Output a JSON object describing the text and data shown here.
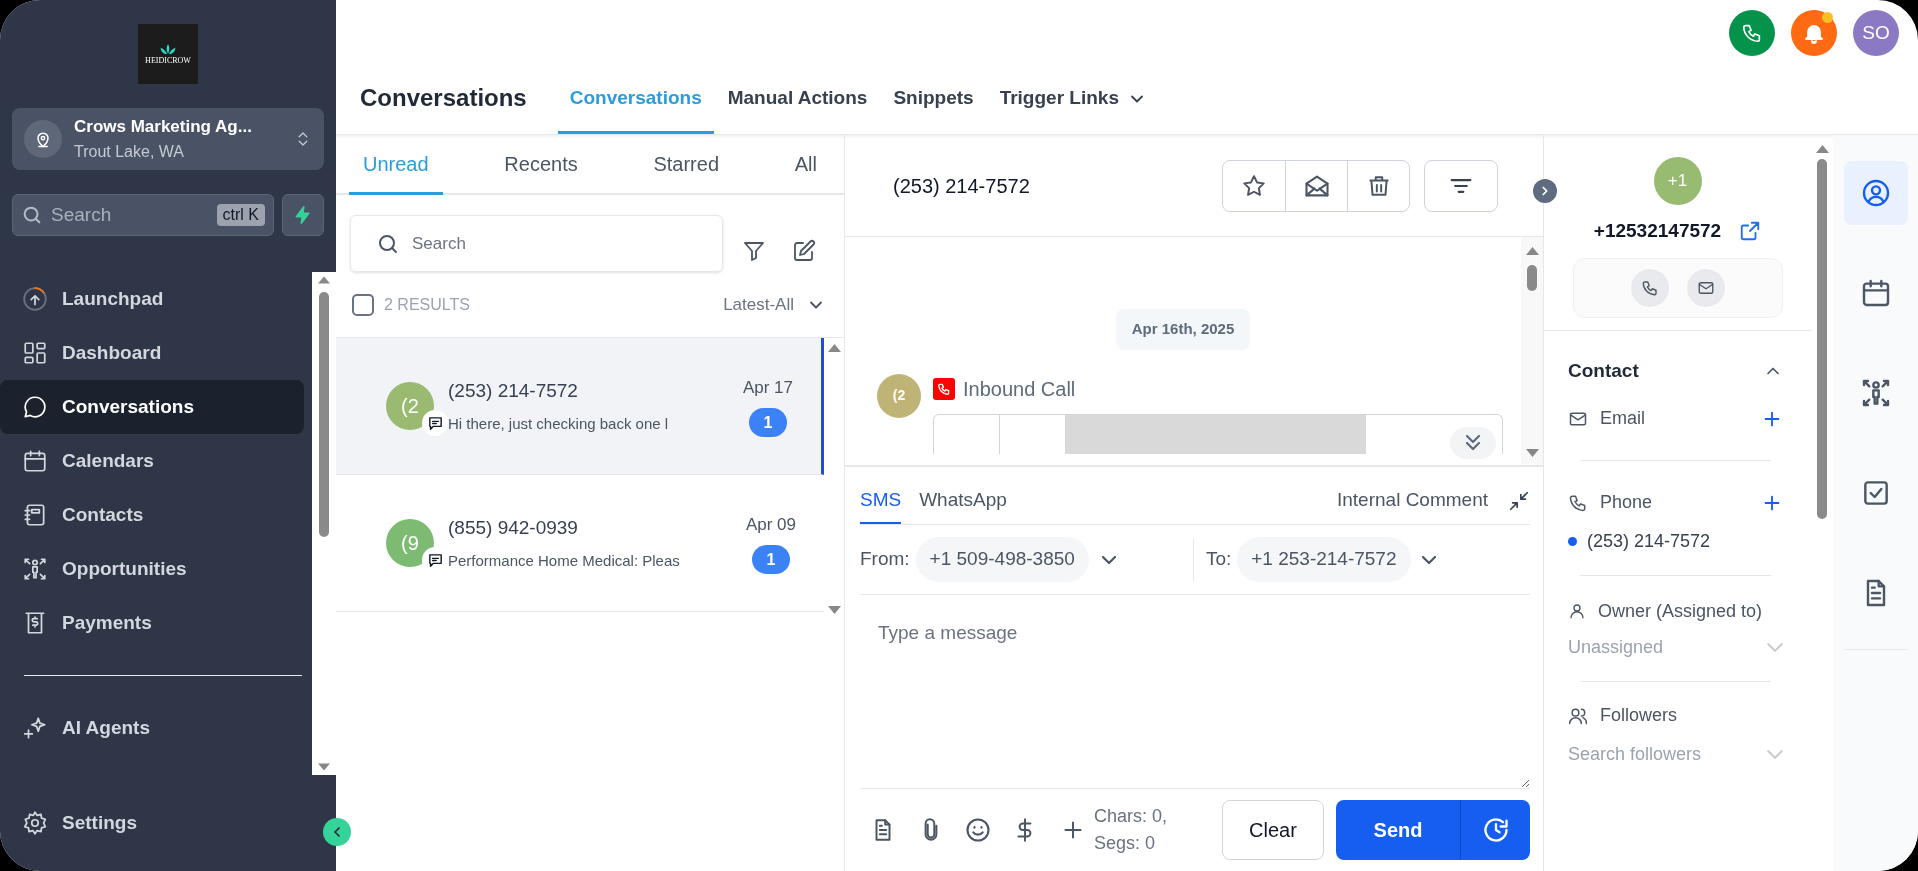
{
  "sidebar": {
    "logo_text": "HEIDICROW",
    "account": {
      "name": "Crows Marketing Ag...",
      "location": "Trout Lake, WA"
    },
    "search": {
      "placeholder": "Search",
      "shortcut": "ctrl K"
    },
    "nav_items": [
      {
        "label": "Launchpad",
        "selected": false
      },
      {
        "label": "Dashboard",
        "selected": false
      },
      {
        "label": "Conversations",
        "selected": true
      },
      {
        "label": "Calendars",
        "selected": false
      },
      {
        "label": "Contacts",
        "selected": false
      },
      {
        "label": "Opportunities",
        "selected": false
      },
      {
        "label": "Payments",
        "selected": false
      }
    ],
    "secondary_items": [
      {
        "label": "AI Agents",
        "selected": false
      }
    ],
    "settings": {
      "label": "Settings"
    }
  },
  "header": {
    "title": "Conversations",
    "tabs": [
      {
        "label": "Conversations",
        "selected": true,
        "has_menu": false
      },
      {
        "label": "Manual Actions",
        "selected": false,
        "has_menu": false
      },
      {
        "label": "Snippets",
        "selected": false,
        "has_menu": false
      },
      {
        "label": "Trigger Links",
        "selected": false,
        "has_menu": true
      }
    ],
    "notification_dot": true,
    "user_initials": "SO"
  },
  "conversation_list": {
    "tabs": [
      {
        "label": "Unread",
        "selected": true
      },
      {
        "label": "Recents",
        "selected": false
      },
      {
        "label": "Starred",
        "selected": false
      },
      {
        "label": "All",
        "selected": false
      }
    ],
    "search_placeholder": "Search",
    "select_all_checked": false,
    "results": "2 RESULTS",
    "sort": "Latest-All",
    "items": [
      {
        "initials": "(2",
        "color": "#9aba72",
        "name": "(253) 214-7572",
        "preview": "Hi there, just checking back one l",
        "date": "Apr 17",
        "unread": "1",
        "selected": true
      },
      {
        "initials": "(9",
        "color": "#7dbb72",
        "name": "(855) 942-0939",
        "preview": "Performance Home Medical: Pleas",
        "date": "Apr 09",
        "unread": "1",
        "selected": false
      }
    ]
  },
  "thread": {
    "title": "(253) 214-7572",
    "date_divider": "Apr 16th, 2025",
    "messages": [
      {
        "initials": "(2",
        "color": "#bfb475",
        "type": "Inbound Call"
      }
    ],
    "composer": {
      "channels": [
        {
          "label": "SMS",
          "selected": true
        },
        {
          "label": "WhatsApp",
          "selected": false
        }
      ],
      "internal_comment": "Internal Comment",
      "from_label": "From:",
      "from": "+1 509-498-3850",
      "to_label": "To:",
      "to": "+1 253-214-7572",
      "placeholder": "Type a message",
      "counter": "Chars: 0, Segs: 0",
      "clear": "Clear",
      "send": "Send"
    }
  },
  "contact": {
    "initials": "+1",
    "color": "#98bb72",
    "phone": "+12532147572",
    "section": "Contact",
    "expanded": true,
    "email_label": "Email",
    "phone_label": "Phone",
    "phone_value": "(253) 214-7572",
    "owner_label": "Owner (Assigned to)",
    "owner_value": "Unassigned",
    "followers_label": "Followers",
    "followers_placeholder": "Search followers"
  },
  "rail": [
    {
      "selected": true
    },
    {
      "selected": false
    },
    {
      "selected": false
    },
    {
      "selected": false
    },
    {
      "selected": false
    }
  ]
}
